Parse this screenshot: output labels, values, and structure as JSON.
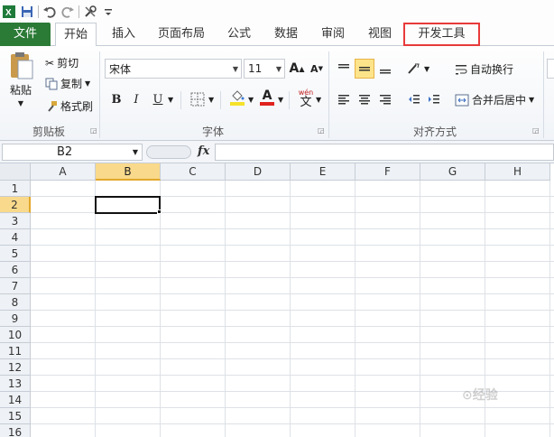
{
  "quick_access": {
    "icons": [
      "excel-logo-icon",
      "save-icon",
      "undo-icon",
      "redo-icon",
      "tools-icon",
      "customize-icon"
    ]
  },
  "tabs": [
    {
      "label": "文件"
    },
    {
      "label": "开始"
    },
    {
      "label": "插入"
    },
    {
      "label": "页面布局"
    },
    {
      "label": "公式"
    },
    {
      "label": "数据"
    },
    {
      "label": "审阅"
    },
    {
      "label": "视图"
    },
    {
      "label": "开发工具"
    }
  ],
  "clipboard": {
    "paste_label": "粘贴",
    "cut_label": "剪切",
    "copy_label": "复制",
    "format_painter_label": "格式刷",
    "group_label": "剪贴板"
  },
  "font": {
    "font_name": "宋体",
    "font_size": "11",
    "bold": "B",
    "italic": "I",
    "underline": "U",
    "grow": "A",
    "shrink": "A",
    "font_color_letter": "A",
    "phonetic_top": "wén",
    "phonetic_bottom": "文",
    "group_label": "字体",
    "highlight_color": "#f5e12a",
    "font_color": "#e0231e"
  },
  "alignment": {
    "wrap_label": "自动换行",
    "merge_label": "合并后居中",
    "group_label": "对齐方式"
  },
  "formula_bar": {
    "name_box": "B2",
    "fx": "fx",
    "value": ""
  },
  "sheet": {
    "columns": [
      "A",
      "B",
      "C",
      "D",
      "E",
      "F",
      "G",
      "H"
    ],
    "rows": [
      "1",
      "2",
      "3",
      "4",
      "5",
      "6",
      "7",
      "8",
      "9",
      "10",
      "11",
      "12",
      "13",
      "14",
      "15",
      "16"
    ],
    "selected_column": "B",
    "selected_row": "2"
  },
  "colors": {
    "file_tab": "#2b7a36",
    "selection_header": "#f9d98b",
    "highlight_box": "#e83a3a"
  }
}
